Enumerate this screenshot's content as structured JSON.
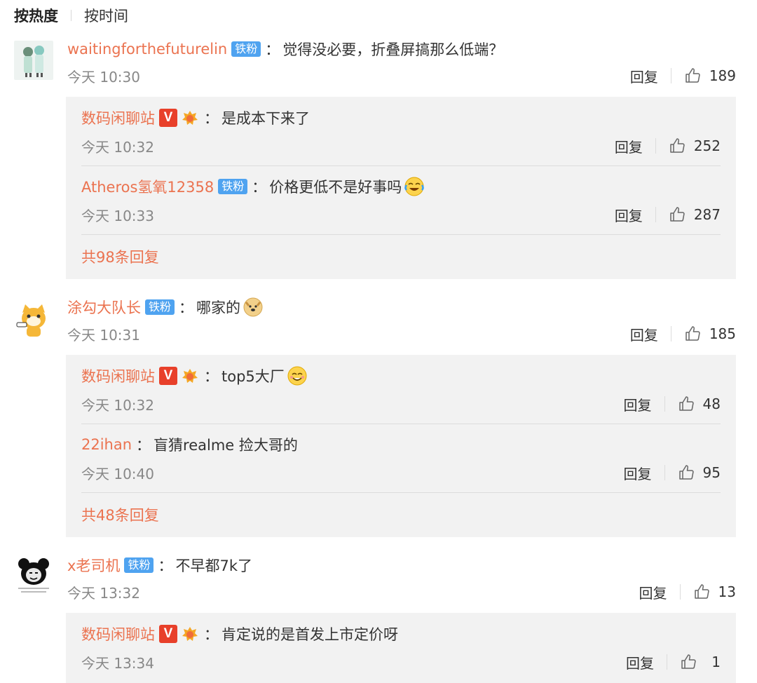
{
  "sort": {
    "active": "按热度",
    "other": "按时间"
  },
  "labels": {
    "fan_badge": "铁粉",
    "reply": "回复",
    "v_badge": "V"
  },
  "colors": {
    "username": "#eb7350",
    "fan_badge": "#4fa3f0",
    "v_badge": "#e8402a",
    "reply_bg": "#f2f2f2"
  },
  "comments": [
    {
      "user": "waitingforthefuturelin",
      "fan": true,
      "text": "觉得没必要，折叠屏搞那么低端？",
      "time": "今天 10:30",
      "likes": "189",
      "avatar_icon": "anime-avatar",
      "replies": [
        {
          "user": "数码闲聊站",
          "verified": true,
          "text": "是成本下来了",
          "time": "今天 10:32",
          "likes": "252"
        },
        {
          "user": "Atheros氢氧12358",
          "fan": true,
          "text": "价格更低不是好事吗",
          "emoji": "laugh-cry-emoji",
          "time": "今天 10:33",
          "likes": "287"
        }
      ],
      "more": "共98条回复"
    },
    {
      "user": "涂勾大队长",
      "fan": true,
      "text": "哪家的",
      "emoji": "doge-emoji",
      "time": "今天 10:31",
      "likes": "185",
      "avatar_icon": "cartoon-cat-avatar",
      "replies": [
        {
          "user": "数码闲聊站",
          "verified": true,
          "text": "top5大厂",
          "emoji": "smile-emoji",
          "time": "今天 10:32",
          "likes": "48"
        },
        {
          "user": "22ihan",
          "text": "盲猜realme 捡大哥的",
          "time": "今天 10:40",
          "likes": "95"
        }
      ],
      "more": "共48条回复"
    },
    {
      "user": "x老司机",
      "fan": true,
      "text": "不早都7k了",
      "time": "今天 13:32",
      "likes": "13",
      "avatar_icon": "panda-meme-avatar",
      "replies": [
        {
          "user": "数码闲聊站",
          "verified": true,
          "text": "肯定说的是首发上市定价呀",
          "time": "今天 13:34",
          "likes": "1"
        }
      ]
    }
  ]
}
